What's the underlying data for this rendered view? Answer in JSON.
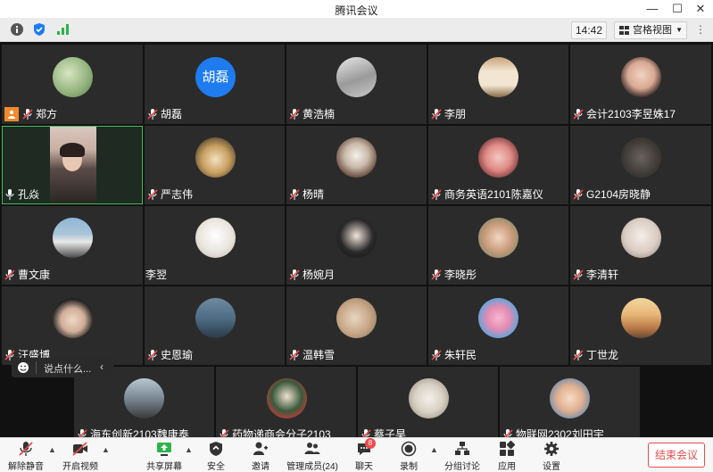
{
  "window": {
    "title": "腾讯会议"
  },
  "toolbar": {
    "time": "14:42",
    "view_label": "宫格视图"
  },
  "participants": [
    {
      "name": "郑方",
      "avatar": "plant-photo"
    },
    {
      "name": "胡磊",
      "avatar": "text",
      "avatar_text": "胡磊"
    },
    {
      "name": "黄浩楠",
      "avatar": "person-lying-photo"
    },
    {
      "name": "李朋",
      "avatar": "calligraphy-photo"
    },
    {
      "name": "会计2103李昱姝17",
      "avatar": "girl-photo"
    },
    {
      "name": "孔焱",
      "avatar": "video"
    },
    {
      "name": "严志伟",
      "avatar": "dog-photo"
    },
    {
      "name": "杨晴",
      "avatar": "kitten-photo"
    },
    {
      "name": "商务英语2101陈嘉仪",
      "avatar": "cartoon-photo"
    },
    {
      "name": "G2104房晓静",
      "avatar": "dim-photo"
    },
    {
      "name": "曹文康",
      "avatar": "car-photo"
    },
    {
      "name": "李翌",
      "avatar": "puppy-photo"
    },
    {
      "name": "杨婉月",
      "avatar": "anime-girl-photo"
    },
    {
      "name": "李晓彤",
      "avatar": "kid-photo"
    },
    {
      "name": "李清轩",
      "avatar": "toddler-photo"
    },
    {
      "name": "汪盛博",
      "avatar": "boy-photo"
    },
    {
      "name": "史恩瑜",
      "avatar": "water-photo"
    },
    {
      "name": "温韩雪",
      "avatar": "cat-photo"
    },
    {
      "name": "朱轩民",
      "avatar": "patrick-photo"
    },
    {
      "name": "丁世龙",
      "avatar": "arch-photo"
    },
    {
      "name": "海东创新2103魏康泰",
      "avatar": "man-photo"
    },
    {
      "name": "药物递商会分子2103",
      "avatar": "green-photo"
    },
    {
      "name": "蔡子昊",
      "avatar": "owl-photo"
    },
    {
      "name": "物联网2302刘田宇",
      "avatar": "baby-photo"
    }
  ],
  "chat_popup": {
    "placeholder": "说点什么..."
  },
  "bottom": {
    "unmute": "解除静音",
    "video": "开启视频",
    "share": "共享屏幕",
    "security": "安全",
    "invite": "邀请",
    "members": "管理成员(24)",
    "chat": "聊天",
    "chat_badge": "8",
    "record": "录制",
    "breakout": "分组讨论",
    "apps": "应用",
    "settings": "设置",
    "end": "结束会议"
  }
}
